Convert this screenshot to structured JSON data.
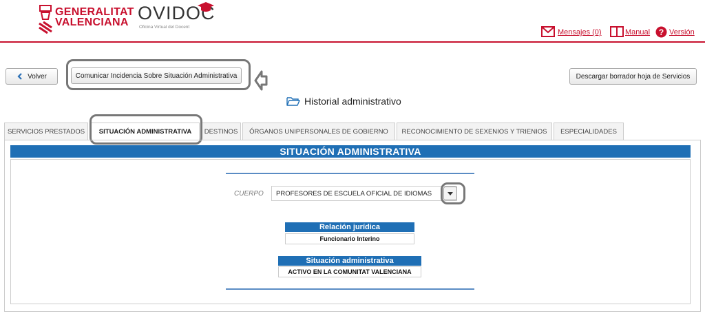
{
  "header": {
    "gva_logo_lines": [
      "GENERALITAT",
      "VALENCIANA"
    ],
    "ovidoc_logo": "OVIDOC",
    "ovidoc_subtitle": "Oficina Virtual del Docent",
    "links": {
      "mensajes": "Mensajes (0)",
      "manual": "Manual",
      "version": "Versión"
    }
  },
  "toolbar": {
    "back_label": "Volver",
    "incidencia_label": "Comunicar Incidencia Sobre Situación Administrativa",
    "download_label": "Descargar borrador hoja de Servicios"
  },
  "page_title": "Historial administrativo",
  "tabs": [
    {
      "label": "SERVICIOS PRESTADOS",
      "active": false
    },
    {
      "label": "SITUACIÓN ADMINISTRATIVA",
      "active": true
    },
    {
      "label": "DESTINOS",
      "active": false
    },
    {
      "label": "ÓRGANOS UNIPERSONALES DE GOBIERNO",
      "active": false
    },
    {
      "label": "RECONOCIMIENTO DE SEXENIOS Y TRIENIOS",
      "active": false
    },
    {
      "label": "ESPECIALIDADES",
      "active": false
    }
  ],
  "section": {
    "banner": "SITUACIÓN ADMINISTRATIVA",
    "cuerpo_label": "CUERPO",
    "cuerpo_value": "PROFESORES DE ESCUELA OFICIAL DE IDIOMAS",
    "relacion_title": "Relación jurídica",
    "relacion_value": "Funcionario Interino",
    "situacion_title": "Situación administrativa",
    "situacion_value": "ACTIVO EN LA COMUNITAT VALENCIANA"
  },
  "colors": {
    "brand_red": "#c8102e",
    "banner_blue": "#1f6fb5",
    "highlight_gray": "#777777"
  }
}
